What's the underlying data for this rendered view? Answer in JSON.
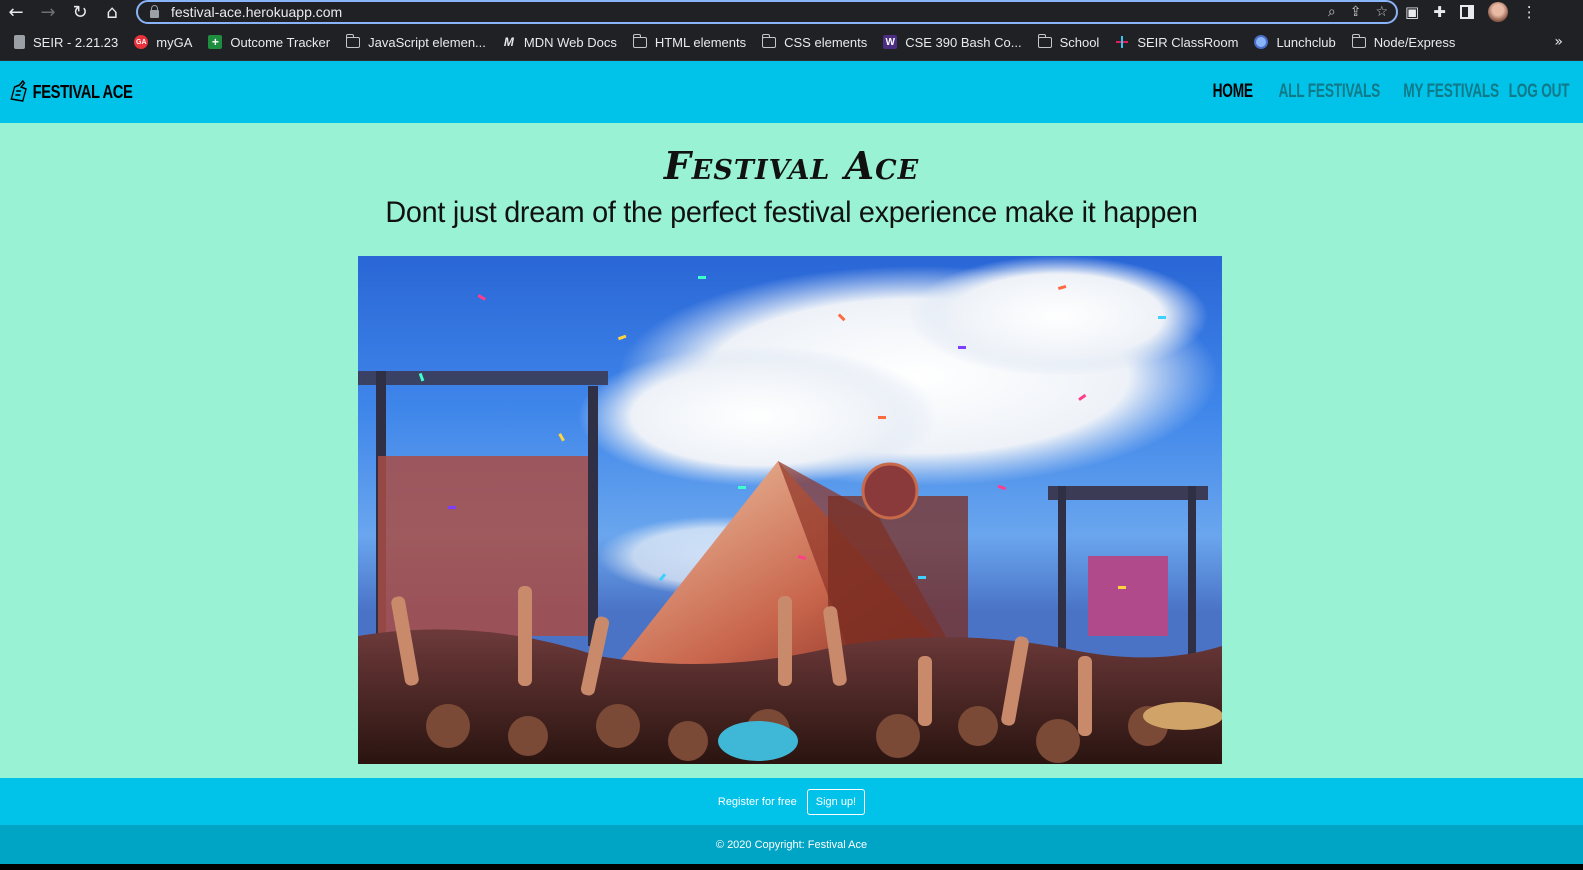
{
  "browser": {
    "url": "festival-ace.herokuapp.com",
    "bookmarks": [
      {
        "label": "SEIR - 2.21.23",
        "icon": "doc-icon"
      },
      {
        "label": "myGA",
        "icon": "ga-icon"
      },
      {
        "label": "Outcome Tracker",
        "icon": "sheets-icon"
      },
      {
        "label": "JavaScript elemen...",
        "icon": "folder-icon"
      },
      {
        "label": "MDN Web Docs",
        "icon": "mdn-icon"
      },
      {
        "label": "HTML elements",
        "icon": "folder-icon"
      },
      {
        "label": "CSS elements",
        "icon": "folder-icon"
      },
      {
        "label": "CSE 390 Bash Co...",
        "icon": "uw-icon"
      },
      {
        "label": "School",
        "icon": "folder-icon"
      },
      {
        "label": "SEIR ClassRoom",
        "icon": "slack-icon"
      },
      {
        "label": "Lunchclub",
        "icon": "lunchclub-icon"
      },
      {
        "label": "Node/Express",
        "icon": "folder-icon"
      }
    ],
    "more_glyph": "»"
  },
  "site": {
    "brand": "FESTIVAL ACE",
    "nav": [
      {
        "label": "HOME",
        "active": true
      },
      {
        "label": "ALL FESTIVALS",
        "active": false
      },
      {
        "label": "MY FESTIVALS",
        "active": false
      },
      {
        "label": "LOG OUT",
        "active": false
      }
    ],
    "title": "Festival Ace",
    "subtitle": "Dont just dream of the perfect festival experience make it happen",
    "hero_image_alt": "festival-crowd-confetti-photo",
    "register_text": "Register for free",
    "signup_label": "Sign up!",
    "copyright": "© 2020 Copyright: Festival Ace"
  },
  "colors": {
    "nav_bg": "#01c3ea",
    "page_bg": "#98f2d3",
    "footer_dark": "#00a4c4",
    "nav_link": "#107a88"
  }
}
